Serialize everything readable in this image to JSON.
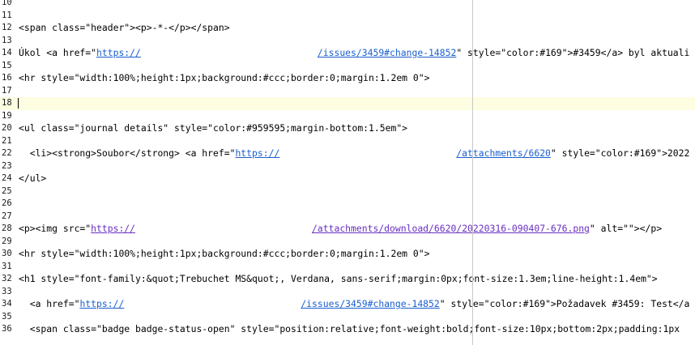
{
  "editor": {
    "current_line": 18,
    "lines": [
      {
        "n": "10",
        "text": "                                        "
      },
      {
        "n": "11",
        "text": ""
      },
      {
        "n": "12",
        "text": "<span class=\"header\"><p>-*-</p></span>"
      },
      {
        "n": "13",
        "text": ""
      },
      {
        "n": "14",
        "pre": "Úkol <a href=\"",
        "url": "https://",
        "url_tail": "/issues/3459#change-14852",
        "post": "\" style=\"color:#169\">#3459</a> byl aktuali"
      },
      {
        "n": "15",
        "text": ""
      },
      {
        "n": "16",
        "text": "<hr style=\"width:100%;height:1px;background:#ccc;border:0;margin:1.2em 0\">"
      },
      {
        "n": "17",
        "text": ""
      },
      {
        "n": "18",
        "text": ""
      },
      {
        "n": "19",
        "text": ""
      },
      {
        "n": "20",
        "text": "<ul class=\"journal details\" style=\"color:#959595;margin-bottom:1.5em\">"
      },
      {
        "n": "21",
        "text": ""
      },
      {
        "n": "22",
        "pre": "  <li><strong>Soubor</strong> <a href=\"",
        "url": "https://",
        "url_tail": "/attachments/6620",
        "post": "\" style=\"color:#169\">2022"
      },
      {
        "n": "23",
        "text": ""
      },
      {
        "n": "24",
        "text": "</ul>"
      },
      {
        "n": "25",
        "text": ""
      },
      {
        "n": "26",
        "text": ""
      },
      {
        "n": "27",
        "text": ""
      },
      {
        "n": "28",
        "pre": "<p><img src=\"",
        "url": "https://",
        "url_tail": "/attachments/download/6620/20220316-090407-676.png",
        "post": "\" alt=\"\"></p>",
        "visited": true
      },
      {
        "n": "29",
        "text": ""
      },
      {
        "n": "30",
        "text": "<hr style=\"width:100%;height:1px;background:#ccc;border:0;margin:1.2em 0\">"
      },
      {
        "n": "31",
        "text": ""
      },
      {
        "n": "32",
        "text": "<h1 style=\"font-family:&quot;Trebuchet MS&quot;, Verdana, sans-serif;margin:0px;font-size:1.3em;line-height:1.4em\">"
      },
      {
        "n": "33",
        "text": ""
      },
      {
        "n": "34",
        "pre": "  <a href=\"",
        "url": "https://",
        "url_tail": "/issues/3459#change-14852",
        "post": "\" style=\"color:#169\">Požadavek #3459: Test</a"
      },
      {
        "n": "35",
        "text": ""
      },
      {
        "n": "36",
        "text": "  <span class=\"badge badge-status-open\" style=\"position:relative;font-weight:bold;font-size:10px;bottom:2px;padding:1px"
      }
    ]
  }
}
